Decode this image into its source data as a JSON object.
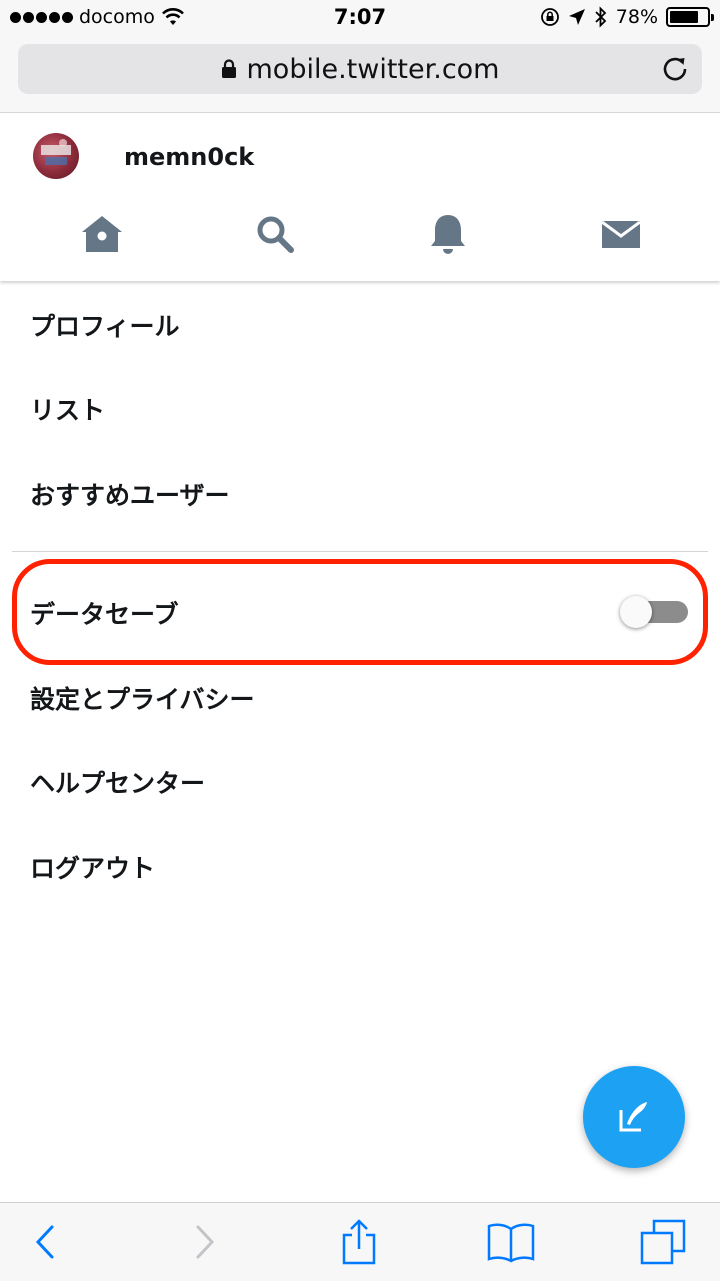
{
  "status_bar": {
    "carrier": "docomo",
    "time": "7:07",
    "battery": "78%",
    "battery_level": 0.78
  },
  "browser": {
    "url": "mobile.twitter.com"
  },
  "profile": {
    "username": "memn0ck"
  },
  "nav": {
    "icons": [
      "home-icon",
      "search-icon",
      "notifications-bell-icon",
      "messages-envelope-icon"
    ]
  },
  "menu": {
    "profile": "プロフィール",
    "lists": "リスト",
    "recommended_users": "おすすめユーザー",
    "data_saver": "データセーブ",
    "data_saver_enabled": false,
    "settings": "設定とプライバシー",
    "help": "ヘルプセンター",
    "logout": "ログアウト"
  },
  "colors": {
    "twitter_blue": "#1da1f2",
    "nav_icon": "#657786",
    "highlight": "#ff2200",
    "ios_blue": "#007aff"
  }
}
